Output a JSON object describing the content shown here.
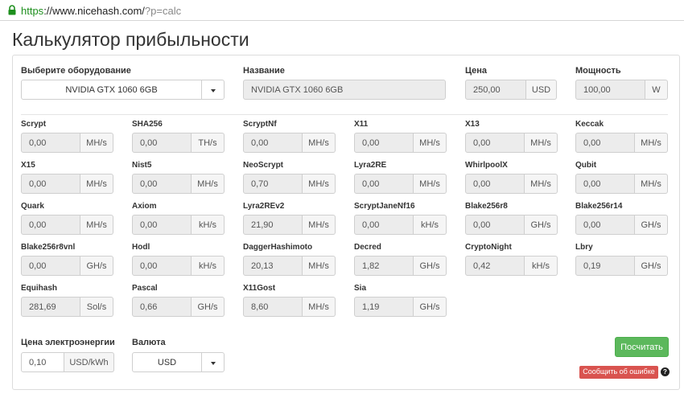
{
  "browser": {
    "url_scheme": "https",
    "url_host": "://www.nicehash.com/",
    "url_query": "?p=calc"
  },
  "page": {
    "title": "Калькулятор прибыльности"
  },
  "hardware": {
    "select_label": "Выберите оборудование",
    "selected": "NVIDIA GTX 1060 6GB",
    "name_label": "Название",
    "name_value": "NVIDIA GTX 1060 6GB",
    "price_label": "Цена",
    "price_value": "250,00",
    "price_unit": "USD",
    "power_label": "Мощность",
    "power_value": "100,00",
    "power_unit": "W"
  },
  "algorithms": [
    {
      "name": "Scrypt",
      "value": "0,00",
      "unit": "MH/s"
    },
    {
      "name": "SHA256",
      "value": "0,00",
      "unit": "TH/s"
    },
    {
      "name": "ScryptNf",
      "value": "0,00",
      "unit": "MH/s"
    },
    {
      "name": "X11",
      "value": "0,00",
      "unit": "MH/s"
    },
    {
      "name": "X13",
      "value": "0,00",
      "unit": "MH/s"
    },
    {
      "name": "Keccak",
      "value": "0,00",
      "unit": "MH/s"
    },
    {
      "name": "X15",
      "value": "0,00",
      "unit": "MH/s"
    },
    {
      "name": "Nist5",
      "value": "0,00",
      "unit": "MH/s"
    },
    {
      "name": "NeoScrypt",
      "value": "0,70",
      "unit": "MH/s"
    },
    {
      "name": "Lyra2RE",
      "value": "0,00",
      "unit": "MH/s"
    },
    {
      "name": "WhirlpoolX",
      "value": "0,00",
      "unit": "MH/s"
    },
    {
      "name": "Qubit",
      "value": "0,00",
      "unit": "MH/s"
    },
    {
      "name": "Quark",
      "value": "0,00",
      "unit": "MH/s"
    },
    {
      "name": "Axiom",
      "value": "0,00",
      "unit": "kH/s"
    },
    {
      "name": "Lyra2REv2",
      "value": "21,90",
      "unit": "MH/s"
    },
    {
      "name": "ScryptJaneNf16",
      "value": "0,00",
      "unit": "kH/s"
    },
    {
      "name": "Blake256r8",
      "value": "0,00",
      "unit": "GH/s"
    },
    {
      "name": "Blake256r14",
      "value": "0,00",
      "unit": "GH/s"
    },
    {
      "name": "Blake256r8vnl",
      "value": "0,00",
      "unit": "GH/s"
    },
    {
      "name": "Hodl",
      "value": "0,00",
      "unit": "kH/s"
    },
    {
      "name": "DaggerHashimoto",
      "value": "20,13",
      "unit": "MH/s"
    },
    {
      "name": "Decred",
      "value": "1,82",
      "unit": "GH/s"
    },
    {
      "name": "CryptoNight",
      "value": "0,42",
      "unit": "kH/s"
    },
    {
      "name": "Lbry",
      "value": "0,19",
      "unit": "GH/s"
    },
    {
      "name": "Equihash",
      "value": "281,69",
      "unit": "Sol/s"
    },
    {
      "name": "Pascal",
      "value": "0,66",
      "unit": "GH/s"
    },
    {
      "name": "X11Gost",
      "value": "8,60",
      "unit": "MH/s"
    },
    {
      "name": "Sia",
      "value": "1,19",
      "unit": "GH/s"
    }
  ],
  "electricity": {
    "label": "Цена электроэнергии",
    "value": "0,10",
    "unit": "USD/kWh"
  },
  "currency": {
    "label": "Валюта",
    "selected": "USD"
  },
  "actions": {
    "calculate": "Посчитать",
    "report_error": "Сообщить об ошибке",
    "help": "?"
  },
  "colors": {
    "accent_green": "#5cb85c",
    "danger_red": "#d9534f",
    "url_green": "#1e8f1e"
  }
}
